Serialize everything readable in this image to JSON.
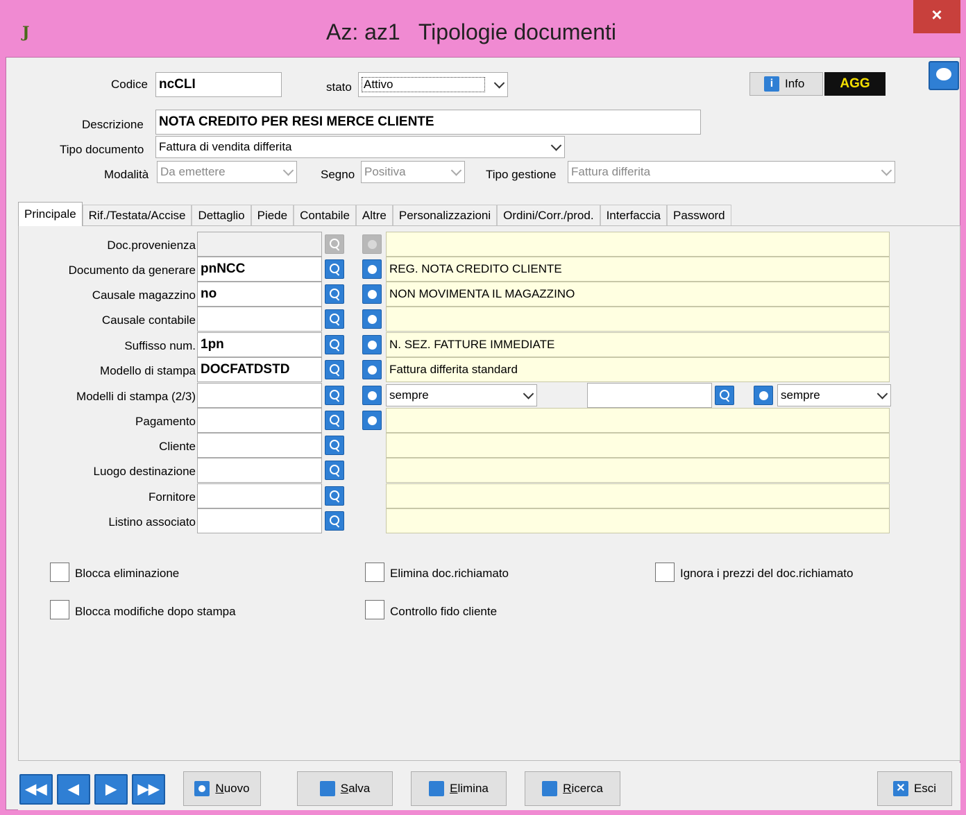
{
  "window": {
    "title": "Az: az1   Tipologie documenti",
    "app_icon": "J",
    "close": "×"
  },
  "header": {
    "codice_label": "Codice",
    "codice_value": "ncCLI",
    "stato_label": "stato",
    "stato_value": "Attivo",
    "info_label": "Info",
    "agg_label": "AGG",
    "descrizione_label": "Descrizione",
    "descrizione_value": "NOTA CREDITO PER RESI MERCE CLIENTE",
    "tipo_documento_label": "Tipo documento",
    "tipo_documento_value": "Fattura di vendita differita",
    "modalita_label": "Modalità",
    "modalita_value": "Da emettere",
    "segno_label": "Segno",
    "segno_value": "Positiva",
    "tipo_gestione_label": "Tipo gestione",
    "tipo_gestione_value": "Fattura differita"
  },
  "tabs": [
    "Principale",
    "Rif./Testata/Accise",
    "Dettaglio",
    "Piede",
    "Contabile",
    "Altre",
    "Personalizzazioni",
    "Ordini/Corr./prod.",
    "Interfaccia",
    "Password"
  ],
  "rows": [
    {
      "label": "Doc.provenienza",
      "value": "",
      "desc": ""
    },
    {
      "label": "Documento da generare",
      "value": "pnNCC",
      "desc": "REG. NOTA CREDITO CLIENTE"
    },
    {
      "label": "Causale magazzino",
      "value": "no",
      "desc": "NON MOVIMENTA IL MAGAZZINO"
    },
    {
      "label": "Causale contabile",
      "value": "",
      "desc": ""
    },
    {
      "label": "Suffisso num.",
      "value": "1pn",
      "desc": "N. SEZ. FATTURE IMMEDIATE"
    },
    {
      "label": "Modello di stampa",
      "value": "DOCFATDSTD",
      "desc": "Fattura differita standard"
    },
    {
      "label": "Modelli di stampa (2/3)",
      "value": "",
      "sel1": "sempre",
      "value2": "",
      "sel2": "sempre"
    },
    {
      "label": "Pagamento",
      "value": "",
      "desc": ""
    },
    {
      "label": "Cliente",
      "value": "",
      "desc": ""
    },
    {
      "label": "Luogo destinazione",
      "value": "",
      "desc": ""
    },
    {
      "label": "Fornitore",
      "value": "",
      "desc": ""
    },
    {
      "label": "Listino associato",
      "value": "",
      "desc": ""
    }
  ],
  "checks": {
    "blocca_eliminazione": "Blocca eliminazione",
    "blocca_modifiche": "Blocca modifiche dopo stampa",
    "elimina_doc": "Elimina doc.richiamato",
    "controllo_fido": "Controllo fido cliente",
    "ignora_prezzi": "Ignora i prezzi del doc.richiamato"
  },
  "buttons": {
    "nuovo_u": "N",
    "nuovo": "uovo",
    "salva_u": "S",
    "salva": "alva",
    "elimina_u": "E",
    "elimina": "limina",
    "ricerca_u": "R",
    "ricerca": "icerca",
    "esci": "Esci"
  }
}
